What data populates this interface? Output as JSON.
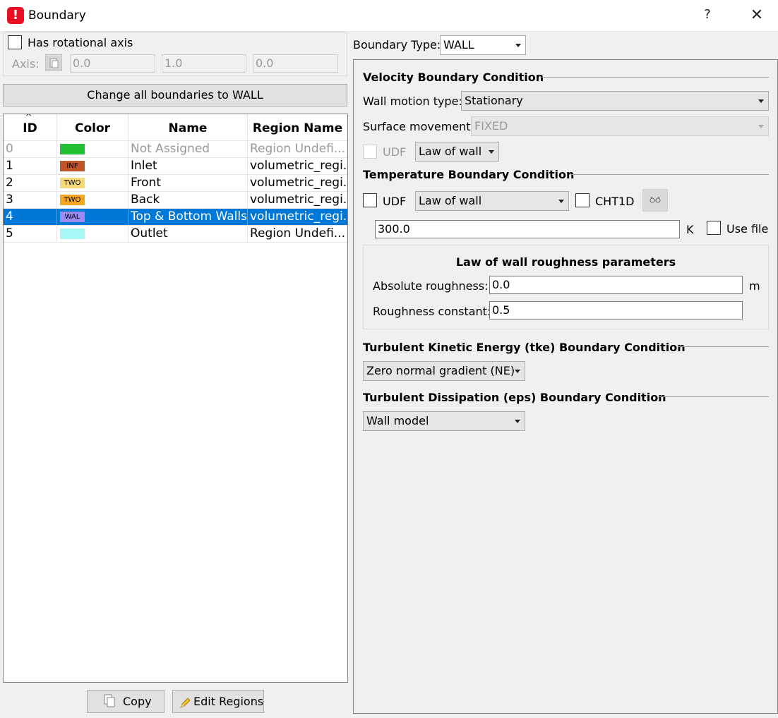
{
  "window": {
    "title": "Boundary",
    "help": "?",
    "close": "✕"
  },
  "rotational": {
    "has_axis_label": "Has rotational axis",
    "axis_label": "Axis:",
    "axis_values": [
      "0.0",
      "1.0",
      "0.0"
    ]
  },
  "change_all_label": "Change all boundaries to WALL",
  "table": {
    "columns": [
      "ID",
      "Color",
      "Name",
      "Region Name"
    ],
    "rows": [
      {
        "id": "0",
        "color": "#22c032",
        "badge": "",
        "name": "Not Assigned",
        "region": "Region Undefi..."
      },
      {
        "id": "1",
        "color": "#c0552a",
        "badge": "INF",
        "name": "Inlet",
        "region": "volumetric_regi..."
      },
      {
        "id": "2",
        "color": "#f5d97a",
        "badge": "TWO",
        "name": "Front",
        "region": "volumetric_regi..."
      },
      {
        "id": "3",
        "color": "#f5a623",
        "badge": "TWO",
        "name": "Back",
        "region": "volumetric_regi..."
      },
      {
        "id": "4",
        "color": "#9b8cf5",
        "badge": "WAL",
        "name": "Top & Bottom Walls",
        "region": "volumetric_regi..."
      },
      {
        "id": "5",
        "color": "#a8f7f7",
        "badge": "",
        "name": "Outlet",
        "region": "Region Undefi..."
      }
    ]
  },
  "bottom_buttons": {
    "copy": "Copy",
    "edit_regions": "Edit Regions"
  },
  "boundary_type": {
    "label": "Boundary Type:",
    "value": "WALL"
  },
  "velocity": {
    "title": "Velocity Boundary Condition",
    "wall_motion_label": "Wall motion type:",
    "wall_motion_value": "Stationary",
    "surface_movement_label": "Surface movement:",
    "surface_movement_value": "FIXED",
    "udf_label": "UDF",
    "law_value": "Law of wall"
  },
  "temperature": {
    "title": "Temperature Boundary Condition",
    "udf_label": "UDF",
    "law_value": "Law of wall",
    "cht1d_label": "CHT1D",
    "value": "300.0",
    "unit": "K",
    "use_file_label": "Use file"
  },
  "roughness": {
    "title": "Law of wall roughness parameters",
    "absolute_label": "Absolute roughness:",
    "absolute_value": "0.0",
    "absolute_unit": "m",
    "constant_label": "Roughness constant:",
    "constant_value": "0.5"
  },
  "tke": {
    "title": "Turbulent Kinetic Energy (tke) Boundary Condition",
    "value": "Zero normal gradient (NE)"
  },
  "eps": {
    "title": "Turbulent Dissipation (eps) Boundary Condition",
    "value": "Wall model"
  },
  "colors": {
    "selection": "#0078d7",
    "app_icon": "#e81123"
  }
}
